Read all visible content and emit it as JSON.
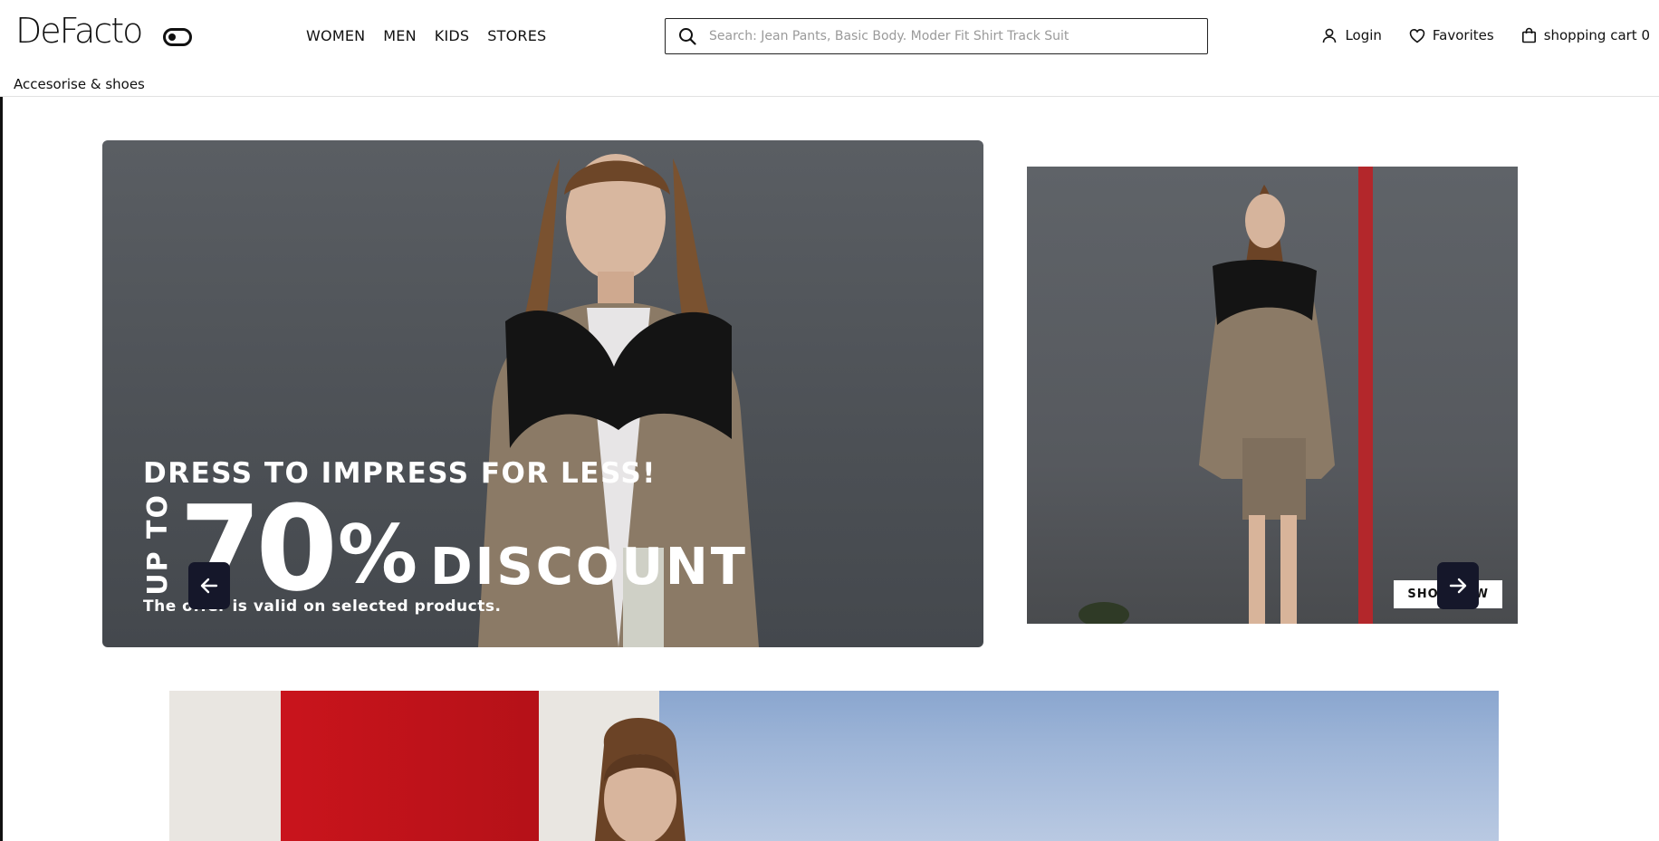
{
  "brand": {
    "logo_text": "DeFacto"
  },
  "nav": {
    "items": [
      "WOMEN",
      "MEN",
      "KIDS",
      "STORES"
    ]
  },
  "search": {
    "placeholder": "Search: Jean Pants, Basic Body. Moder Fit Shirt Track Suit"
  },
  "header_actions": {
    "login": "Login",
    "favorites": "Favorites",
    "cart": "shopping cart 0"
  },
  "subnav": {
    "label": "Accesorise & shoes"
  },
  "hero": {
    "headline": "DRESS TO IMPRESS FOR LESS!",
    "up_to": "UP TO",
    "percent": "70",
    "percent_sign": "%",
    "discount": "DISCOUNT",
    "note": "The offer is valid on selected products.",
    "cta": "SHOP NOW"
  },
  "colors": {
    "accent": "#15172a",
    "banner_red": "#c9141c",
    "hero_bg": "#4c5055"
  },
  "icons": [
    "toggle-icon",
    "search-icon",
    "user-icon",
    "heart-icon",
    "bag-icon",
    "arrow-left-icon",
    "arrow-right-icon"
  ]
}
